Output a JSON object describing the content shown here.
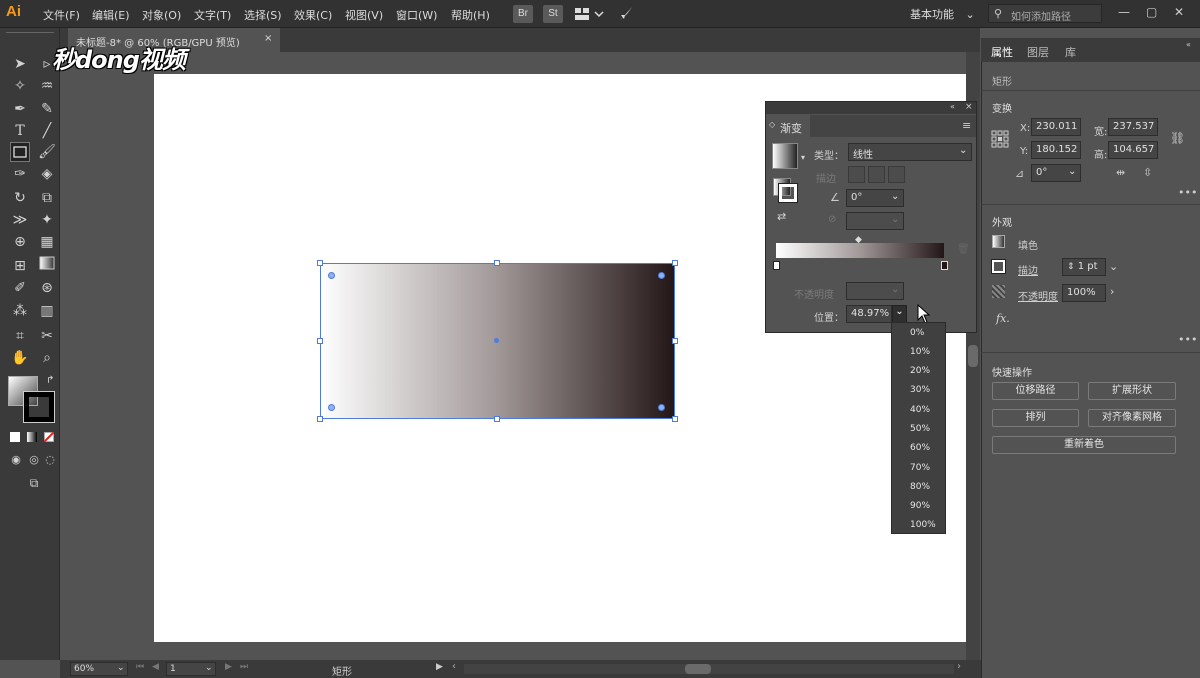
{
  "app": {
    "logo_text": "Ai",
    "menu": [
      "文件(F)",
      "编辑(E)",
      "对象(O)",
      "文字(T)",
      "选择(S)",
      "效果(C)",
      "视图(V)",
      "窗口(W)",
      "帮助(H)"
    ],
    "bridge_btn": "Br",
    "stock_btn": "St",
    "workspace": "基本功能",
    "search_placeholder": "如何添加路径"
  },
  "document": {
    "tab_title": "未标题-8* @ 60% (RGB/GPU 预览)",
    "tab_close": "×"
  },
  "watermark": "秒dong视频",
  "gradient_panel": {
    "title": "渐变",
    "type_label": "类型：",
    "type_value": "线性",
    "stroke_label": "描边",
    "angle_value": "0°",
    "opacity_label": "不透明度",
    "location_label": "位置：",
    "location_value": "48.97%",
    "stops": {
      "start_color": "#ffffff",
      "mid_color": "#a39a9a",
      "end_color": "#231616",
      "midpoint_percent": 48.97
    }
  },
  "location_dropdown": {
    "options": [
      "0%",
      "10%",
      "20%",
      "30%",
      "40%",
      "50%",
      "60%",
      "70%",
      "80%",
      "90%",
      "100%"
    ]
  },
  "properties": {
    "tabs": [
      "属性",
      "图层",
      "库"
    ],
    "object_type": "矩形",
    "transform_title": "变换",
    "x_label": "X:",
    "x_value": "230.011",
    "y_label": "Y:",
    "y_value": "180.152",
    "w_label": "宽:",
    "w_value": "237.537",
    "h_label": "高:",
    "h_value": "104.657",
    "rotate_value": "0°",
    "appearance_title": "外观",
    "fill_label": "填色",
    "stroke_label": "描边",
    "stroke_value": "1 pt",
    "opacity_label": "不透明度",
    "opacity_value": "100%",
    "fx_label": "fx.",
    "quick_actions_title": "快速操作",
    "buttons": [
      "位移路径",
      "扩展形状",
      "排列",
      "对齐像素网格",
      "重新着色"
    ]
  },
  "status": {
    "zoom": "60%",
    "artboard_num": "1",
    "tool_name": "矩形"
  }
}
